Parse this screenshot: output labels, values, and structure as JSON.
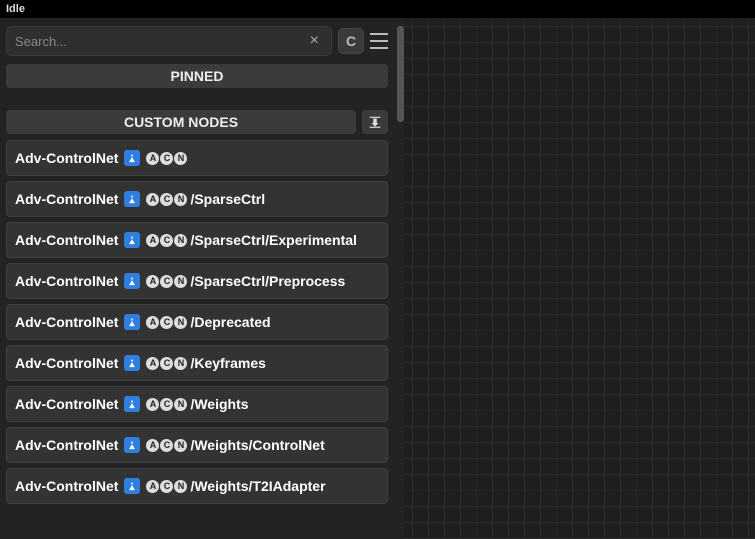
{
  "titlebar": {
    "status": "Idle"
  },
  "search": {
    "placeholder": "Search...",
    "value": "",
    "clear_glyph": "×",
    "c_label": "C"
  },
  "sections": {
    "pinned_label": "PINNED",
    "custom_label": "CUSTOM NODES"
  },
  "node_prefix": "Adv-ControlNet",
  "node_circle_labels": [
    "A",
    "C",
    "N"
  ],
  "node_suffixes": [
    "",
    "/SparseCtrl",
    "/SparseCtrl/Experimental",
    "/SparseCtrl/Preprocess",
    "/Deprecated",
    "/Keyframes",
    "/Weights",
    "/Weights/ControlNet",
    "/Weights/T2IAdapter"
  ]
}
